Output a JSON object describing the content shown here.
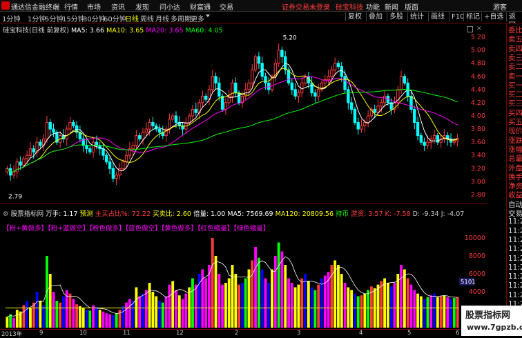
{
  "topbar": {
    "app_name": "通达信金融终端",
    "menus": [
      "行情",
      "市场",
      "资讯",
      "发现",
      "问小达",
      "财富通",
      "交易"
    ],
    "warning": "证券交易未登录",
    "stock": "硅宝科技",
    "right_menus": [
      "功能",
      "新闻",
      "版面",
      "游客"
    ]
  },
  "periodbar": {
    "periods": [
      "1分钟",
      "1分钟",
      "5分钟",
      "15分钟",
      "30分钟",
      "60分钟",
      "日线",
      "周线",
      "月线",
      "多周期",
      "更多"
    ],
    "active": "日线",
    "tools": [
      "复权",
      "叠加",
      "多股",
      "统计",
      "画线",
      "F10",
      "标记",
      "+自选",
      "返回"
    ]
  },
  "main_info": {
    "title": "硅宝科技(日线 前复权)",
    "ma5": "MA5: 3.66",
    "ma10": "MA10: 3.65",
    "ma20": "MA20: 3.65",
    "ma60": "MA60: 4.05",
    "high_label": "5.20",
    "low_label": "2.79"
  },
  "vol_info": {
    "name": "股票指标网",
    "wan": "万手: 1.17",
    "yuce": "预测",
    "zhu": "主买占比%: 72.22",
    "maimai": "买卖比: 2.60",
    "beiliang": "倍量: 1.00",
    "ma5": "MA5: 7569.69",
    "ma120": "MA120: 20809.56",
    "chi": "持币",
    "zhuli": "游资: 3.57 K: -7.58",
    "dj": "D: -9.34 J: -4.07",
    "tags": "【粉+黄做多】【粉+蓝做空】【粉色做多】【蓝色做空】【黄色做多】【红色缩量】【绿色缩量】",
    "vol_label": "5101"
  },
  "colors": {
    "up": "#ff3c3c",
    "down": "#00ffff",
    "ma5": "#ffffff",
    "ma10": "#ffff00",
    "ma20": "#ff00ff",
    "ma60": "#00ff00"
  },
  "price_axis": [
    "5.20",
    "5.00",
    "4.80",
    "4.60",
    "4.40",
    "4.20",
    "4.00",
    "3.80",
    "3.60",
    "3.40",
    "3.20",
    "3.00",
    "2.80"
  ],
  "vol_axis": [
    "10000",
    "8000",
    "6000",
    "4000",
    "2000"
  ],
  "dates": [
    "2013年",
    "9",
    "10",
    "11",
    "12",
    "2",
    "3",
    "4",
    "5",
    "6"
  ],
  "right_panel": [
    "委比",
    "卖五",
    "卖四",
    "卖三",
    "卖二",
    "卖一",
    "买一",
    "买二",
    "买三",
    "买四",
    "买五",
    "现价",
    "涨跌",
    "涨幅",
    "总量",
    "外盘",
    "换手",
    "净资",
    "收益",
    "自动",
    "交易",
    "11:2",
    "11:2",
    "11:2",
    "11:2",
    "11:2",
    "11:2",
    "11:2",
    "11:2",
    "11:2",
    "11:2",
    "11:2",
    "11:2",
    "11:2"
  ],
  "watermark": {
    "line1": "股票指标网",
    "line2": "www.7gpzb.com"
  },
  "chart_data": {
    "type": "candlestick",
    "title": "硅宝科技(日线 前复权)",
    "ylim": [
      2.7,
      5.3
    ],
    "annotations": [
      "5.20",
      "2.79"
    ],
    "closes": [
      3.2,
      3.1,
      3.15,
      3.3,
      3.25,
      3.35,
      3.4,
      3.5,
      3.45,
      3.6,
      3.55,
      3.65,
      3.9,
      3.8,
      3.75,
      3.6,
      3.7,
      3.65,
      3.8,
      3.9,
      3.85,
      3.75,
      3.65,
      3.55,
      3.5,
      3.45,
      3.6,
      3.55,
      3.5,
      3.4,
      3.3,
      3.2,
      3.05,
      3.1,
      3.2,
      3.3,
      3.4,
      3.5,
      3.55,
      3.7,
      3.65,
      3.75,
      3.8,
      3.9,
      3.85,
      3.8,
      3.75,
      3.7,
      3.8,
      3.95,
      4.0,
      3.9,
      3.85,
      3.8,
      3.9,
      4.0,
      4.1,
      4.05,
      4.2,
      4.3,
      4.25,
      4.4,
      4.6,
      4.5,
      4.3,
      4.1,
      4.2,
      4.3,
      4.5,
      4.35,
      4.2,
      4.3,
      4.4,
      4.5,
      4.7,
      4.9,
      4.8,
      4.6,
      4.5,
      4.4,
      4.6,
      4.8,
      5.0,
      4.9,
      4.7,
      4.5,
      4.4,
      4.3,
      4.35,
      4.5,
      4.6,
      4.5,
      4.35,
      4.3,
      4.4,
      4.5,
      4.55,
      4.6,
      4.7,
      4.8,
      4.75,
      4.6,
      4.4,
      4.2,
      4.1,
      3.9,
      3.8,
      3.85,
      3.9,
      4.0,
      4.1,
      4.05,
      4.15,
      4.2,
      4.3,
      4.2,
      4.1,
      4.2,
      4.4,
      4.6,
      4.5,
      4.3,
      4.1,
      3.9,
      3.7,
      3.6,
      3.55,
      3.6,
      3.65,
      3.7,
      3.6,
      3.65,
      3.7,
      3.65,
      3.6,
      3.62,
      3.66
    ],
    "volumes": [
      1200,
      1500,
      1100,
      2000,
      1800,
      2500,
      3000,
      2200,
      2800,
      4000,
      3000,
      2500,
      8000,
      6000,
      4000,
      3000,
      2800,
      3500,
      4200,
      3800,
      3200,
      2600,
      2400,
      2200,
      2000,
      1900,
      2500,
      2300,
      2000,
      1800,
      1600,
      1500,
      1400,
      1600,
      2000,
      2400,
      2800,
      3200,
      3000,
      4500,
      3500,
      3800,
      4200,
      5000,
      4000,
      3500,
      3000,
      2800,
      3500,
      4800,
      5200,
      4200,
      3600,
      3200,
      3800,
      4500,
      5500,
      4800,
      6000,
      6500,
      5500,
      7000,
      10000,
      8000,
      6000,
      4800,
      5000,
      5500,
      7000,
      6000,
      4800,
      5000,
      5500,
      6500,
      7500,
      9000,
      7800,
      6500,
      5500,
      5000,
      6500,
      8000,
      9500,
      8500,
      7000,
      5500,
      5000,
      4500,
      4800,
      5500,
      6000,
      5200,
      4500,
      4200,
      4800,
      5500,
      5800,
      6200,
      7000,
      7500,
      7000,
      6000,
      5000,
      4500,
      4200,
      3800,
      3500,
      3600,
      3800,
      4200,
      4600,
      4400,
      4800,
      5200,
      5500,
      5000,
      4600,
      5000,
      6000,
      7000,
      6500,
      5500,
      4800,
      4200,
      3800,
      3500,
      3200,
      3400,
      3600,
      3800,
      3400,
      3500,
      3600,
      3400,
      3200,
      3300,
      3400
    ],
    "ma60_line": "smooth rising from 2.9 to 4.0"
  }
}
